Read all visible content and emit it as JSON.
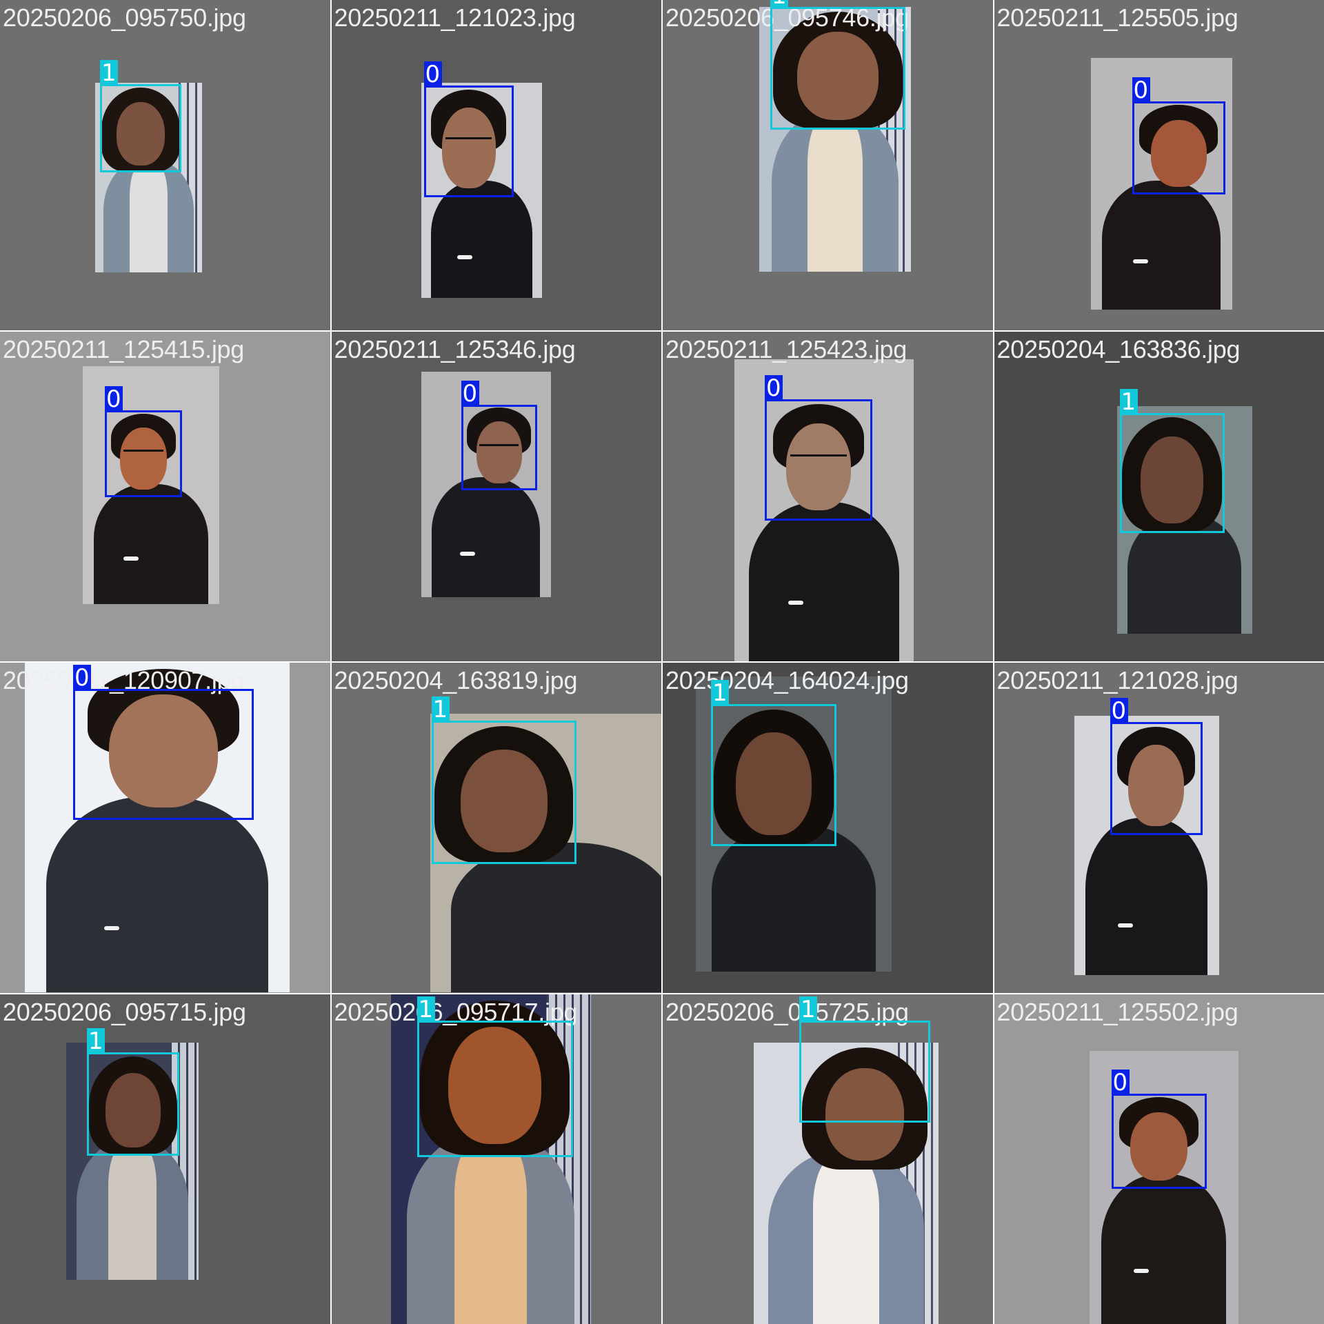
{
  "class_colors": {
    "0": "#0a22e6",
    "1": "#12c9dc"
  },
  "tiles": [
    {
      "filename": "20250206_095750.jpg",
      "bg": "#6f6f6f",
      "label": "1",
      "person": "woman",
      "wall": "#c9ced2",
      "top": "#dedede",
      "outer": "#7e8fa0",
      "skin": "#7c5240",
      "hair": "#1e1410",
      "stripes": true
    },
    {
      "filename": "20250211_121023.jpg",
      "bg": "#5b5b5b",
      "label": "0",
      "person": "man",
      "wall": "#cfd0d4",
      "top": "#15151a",
      "skin": "#9a6d54",
      "hair": "#17120f",
      "glasses": true
    },
    {
      "filename": "20250206_095746.jpg",
      "bg": "#6f6f6f",
      "label": "1",
      "person": "woman",
      "wall": "#b9c3cf",
      "top": "#e8dccb",
      "outer": "#7f8ea0",
      "skin": "#8a5c45",
      "hair": "#1b120d",
      "stripes": true
    },
    {
      "filename": "20250211_125505.jpg",
      "bg": "#6f6f6f",
      "label": "0",
      "person": "man",
      "wall": "#b9b9bc",
      "top": "#1c1716",
      "skin": "#a5573a",
      "hair": "#18100c"
    },
    {
      "filename": "20250211_125415.jpg",
      "bg": "#9a9a9a",
      "label": "0",
      "person": "man",
      "wall": "#c4c2c2",
      "top": "#1c1818",
      "skin": "#b0633f",
      "hair": "#1a120e",
      "glasses": true
    },
    {
      "filename": "20250211_125346.jpg",
      "bg": "#5b5b5b",
      "label": "0",
      "person": "man",
      "wall": "#b5b5b8",
      "top": "#1b1b1f",
      "skin": "#8e6450",
      "hair": "#17120f",
      "glasses": true
    },
    {
      "filename": "20250211_125423.jpg",
      "bg": "#6f6f6f",
      "label": "0",
      "person": "man",
      "wall": "#bdbdbd",
      "top": "#18181a",
      "skin": "#a07b66",
      "hair": "#16110e",
      "glasses": true
    },
    {
      "filename": "20250204_163836.jpg",
      "bg": "#4a4a4a",
      "label": "1",
      "person": "woman",
      "wall": "#7d8a8c",
      "top": "#25272a",
      "skin": "#6b4636",
      "hair": "#16100c"
    },
    {
      "filename": "20250211_120907.jpg",
      "bg": "#9a9a9a",
      "label": "0",
      "person": "man",
      "wall": "#eef1f5",
      "top": "#2d2f36",
      "skin": "#a27259",
      "hair": "#1a130f"
    },
    {
      "filename": "20250204_163819.jpg",
      "bg": "#6f6f6f",
      "label": "1",
      "person": "woman",
      "wall": "#b8b3a6",
      "top": "#26272b",
      "skin": "#7b513e",
      "hair": "#15100c"
    },
    {
      "filename": "20250204_164024.jpg",
      "bg": "#4a4a4a",
      "label": "1",
      "person": "woman",
      "wall": "#5c6264",
      "top": "#1d1e21",
      "skin": "#6e4634",
      "hair": "#130d0a"
    },
    {
      "filename": "20250211_121028.jpg",
      "bg": "#6f6f6f",
      "label": "0",
      "person": "man",
      "wall": "#d4d6da",
      "top": "#18181b",
      "skin": "#9a6b55",
      "hair": "#16110e"
    },
    {
      "filename": "20250206_095715.jpg",
      "bg": "#5b5b5b",
      "label": "1",
      "person": "woman",
      "wall": "#3d4156",
      "top": "#cdc7bf",
      "outer": "#6b7588",
      "skin": "#6f4535",
      "hair": "#1a110d",
      "stripes": true
    },
    {
      "filename": "20250206_095717.jpg",
      "bg": "#6f6f6f",
      "label": "1",
      "person": "woman",
      "wall": "#2c2f54",
      "top": "#e4b98c",
      "outer": "#7d8290",
      "skin": "#a1552c",
      "hair": "#1a0f08",
      "stripes": true
    },
    {
      "filename": "20250206_095725.jpg",
      "bg": "#6f6f6f",
      "label": "1",
      "person": "woman",
      "wall": "#d6d9e0",
      "top": "#f1eeea",
      "outer": "#7b8aa0",
      "skin": "#83563f",
      "hair": "#1b120d",
      "stripes": true
    },
    {
      "filename": "20250211_125502.jpg",
      "bg": "#9a9a9a",
      "label": "0",
      "person": "man",
      "wall": "#b3b3b8",
      "top": "#1e1817",
      "skin": "#9e5a3c",
      "hair": "#1a110d"
    }
  ]
}
